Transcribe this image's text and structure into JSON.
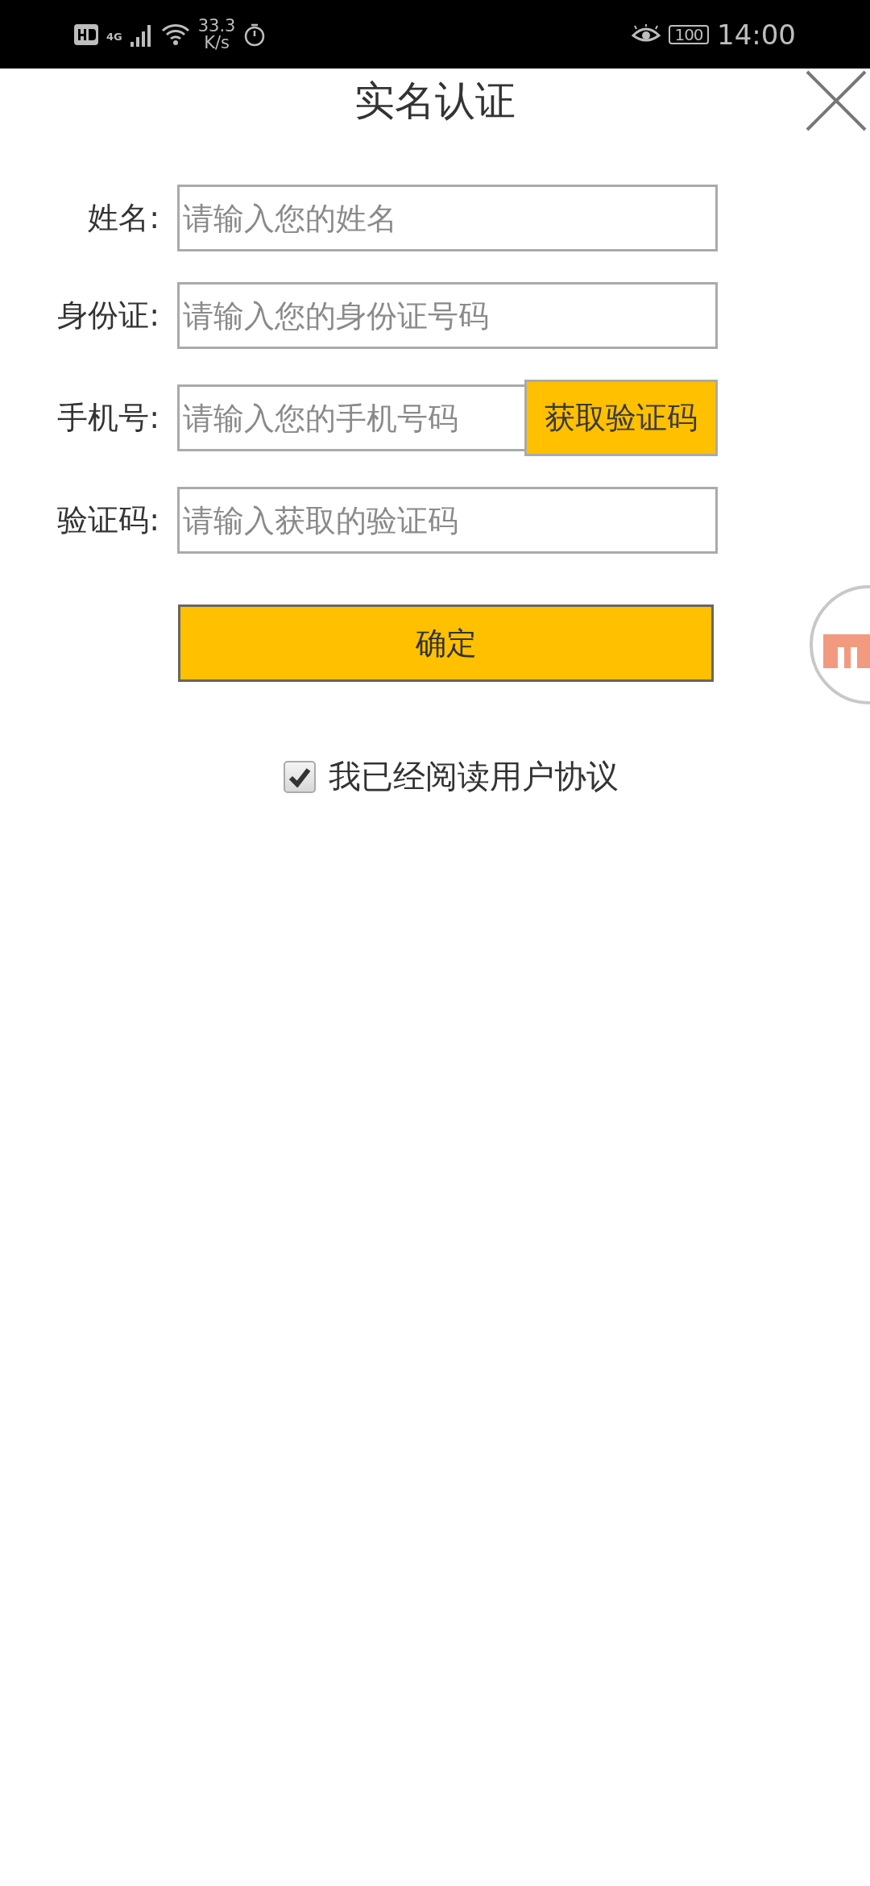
{
  "status_bar": {
    "network": "4G",
    "speed_value": "33.3",
    "speed_unit": "K/s",
    "battery": "100",
    "time": "14:00"
  },
  "header": {
    "title": "实名认证"
  },
  "form": {
    "fields": [
      {
        "kind": "input",
        "label": "姓名:",
        "placeholder": "请输入您的姓名"
      },
      {
        "kind": "input",
        "label": "身份证:",
        "placeholder": "请输入您的身份证号码"
      },
      {
        "kind": "input_with_button",
        "label": "手机号:",
        "placeholder": "请输入您的手机号码",
        "button": "获取验证码"
      },
      {
        "kind": "input",
        "label": "验证码:",
        "placeholder": "请输入获取的验证码"
      }
    ],
    "submit": "确定"
  },
  "agreement": {
    "label": "我已经阅读用户协议",
    "checked": true
  }
}
